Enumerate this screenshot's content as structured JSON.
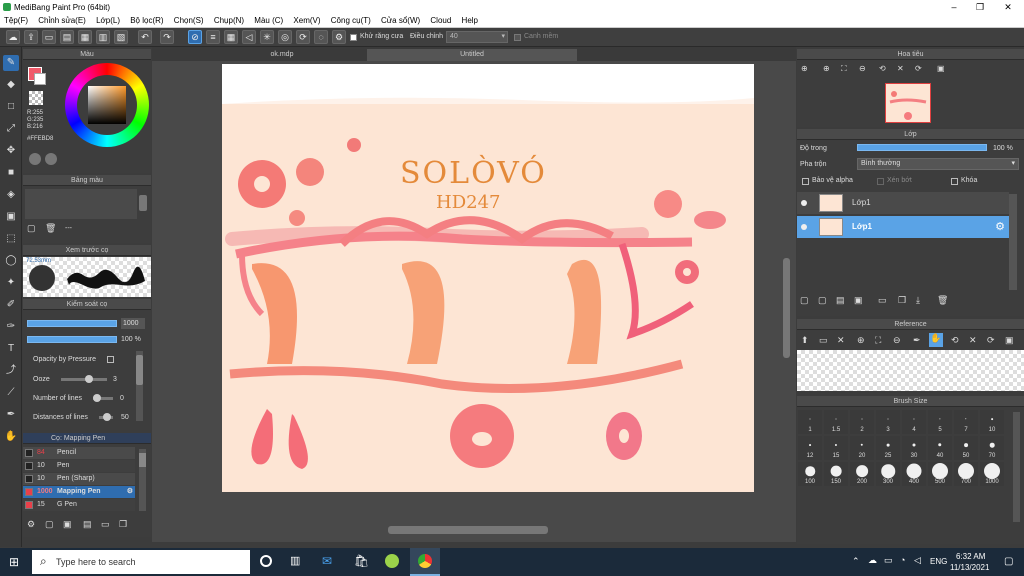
{
  "window": {
    "title": "MediBang Paint Pro (64bit)"
  },
  "menu": [
    "Tệp(F)",
    "Chỉnh sửa(E)",
    "Lớp(L)",
    "Bộ lọc(R)",
    "Chọn(S)",
    "Chụp(N)",
    "Màu (C)",
    "Xem(V)",
    "Công cụ(T)",
    "Cửa sổ(W)",
    "Cloud",
    "Help"
  ],
  "toolbar": {
    "antialias_label": "Khử răng cưa",
    "adjust_label": "Điều chỉnh",
    "adjust_value": "40",
    "snap_label": "Canh mềm"
  },
  "tabs": [
    "ok.mdp",
    "Untitled"
  ],
  "color_panel": {
    "title": "Màu",
    "r": "R:255",
    "g": "G:235",
    "b": "B:216",
    "hex": "#FFEBD8",
    "fg_color": "#f05a6a",
    "bg_color": "#ffffff"
  },
  "palette_panel": {
    "title": "Bảng màu",
    "dash": "---"
  },
  "brush_preview": {
    "title": "Xem trước cọ",
    "size": "72.53mm"
  },
  "brush_control": {
    "title": "Kiểm soát cọ",
    "size_value": "1000",
    "opacity_value": "100 %",
    "opacity_by_pressure": "Opacity by Pressure",
    "ooze_label": "Ooze",
    "ooze_value": "3",
    "lines_label": "Number of lines",
    "lines_value": "0",
    "distance_label": "Distances of lines",
    "distance_value": "50"
  },
  "brush_list": {
    "title": "Cọ: Mapping Pen",
    "items": [
      {
        "size": "84",
        "name": "Pencil",
        "color": "#222222"
      },
      {
        "size": "10",
        "name": "Pen",
        "color": "#222222"
      },
      {
        "size": "10",
        "name": "Pen (Sharp)",
        "color": "#222222"
      },
      {
        "size": "1000",
        "name": "Mapping Pen",
        "color": "#e8404a"
      },
      {
        "size": "15",
        "name": "G Pen",
        "color": "#e8404a"
      }
    ]
  },
  "navigator": {
    "title": "Hoa tiêu"
  },
  "layer_panel": {
    "title": "Lớp",
    "opacity_label": "Độ trong",
    "opacity_value": "100 %",
    "blend_label": "Pha trộn",
    "blend_value": "Bình thường",
    "protect_alpha": "Bảo vệ alpha",
    "clipping": "Xén bớt",
    "lock": "Khóa",
    "layers": [
      "Lớp1",
      "Lớp1"
    ]
  },
  "reference_panel": {
    "title": "Reference"
  },
  "brush_size_panel": {
    "title": "Brush Size",
    "sizes": [
      "1",
      "1.5",
      "2",
      "3",
      "4",
      "5",
      "7",
      "10",
      "12",
      "15",
      "20",
      "25",
      "30",
      "40",
      "50",
      "70",
      "100",
      "150",
      "200",
      "300",
      "400",
      "500",
      "700",
      "1000"
    ]
  },
  "canvas_text": {
    "line1": "SOLÒVÓ",
    "line2": "HD247"
  },
  "taskbar": {
    "search_placeholder": "Type here to search",
    "lang": "ENG",
    "time": "6:32 AM",
    "date": "11/13/2021"
  }
}
